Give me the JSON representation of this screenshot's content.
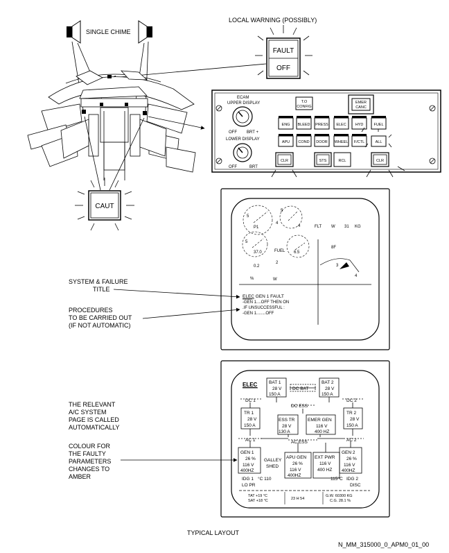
{
  "labels": {
    "local_warning": "LOCAL WARNING (POSSIBLY)",
    "single_chime": "SINGLE CHIME",
    "fault": "FAULT",
    "off": "OFF",
    "caut": "CAUT",
    "system_failure_title_1": "SYSTEM & FAILURE",
    "system_failure_title_2": "TITLE",
    "procedures_1": "PROCEDURES",
    "procedures_2": "TO BE CARRIED OUT",
    "procedures_3": "(IF NOT AUTOMATIC)",
    "relevant_1": "THE RELEVANT",
    "relevant_2": "A/C SYSTEM",
    "relevant_3": "PAGE IS CALLED",
    "relevant_4": "AUTOMATICALLY",
    "colour_1": "COLOUR FOR",
    "colour_2": "THE FAULTY",
    "colour_3": "PARAMETERS",
    "colour_4": "CHANGES TO",
    "colour_5": "AMBER",
    "typical_layout": "TYPICAL LAYOUT",
    "figure_id": "N_MM_315000_0_APM0_01_00"
  },
  "ecam_panel": {
    "ecam": "ECAM",
    "upper_display": "UPPER DISPLAY",
    "lower_display": "LOWER DISPLAY",
    "off_upper": "OFF",
    "brt_upper": "BRT +",
    "off_lower": "OFF",
    "brt_lower": "BRT",
    "to_config_1": "T.O",
    "to_config_2": "CONFIG",
    "emer_canc_1": "EMER",
    "emer_canc_2": "CANC",
    "row1": [
      "ENG",
      "BLEED",
      "PRESS",
      "ELEC",
      "HYD",
      "FUEL"
    ],
    "row2": [
      "APU",
      "COND",
      "DOOR",
      "WHEEL",
      "F/CTL",
      "ALL"
    ],
    "clr_left": "CLR",
    "sts": "STS",
    "rcl": "RCL",
    "clr_right": "CLR"
  },
  "ewd": {
    "line_title_underlined": "ELEC",
    "line_title_rest": " GEN 1 FAULT",
    "line_2": "-GEN 1....OFF THEN ON",
    "line_3": ".IF UNSUCCESSFUL :",
    "line_4": "-GEN 1........OFF",
    "gauge_marks": [
      "5",
      "P1",
      "4",
      "5",
      "4",
      "5",
      "37.0",
      "FUEL",
      "6.5",
      "0.2",
      "2",
      "FLT",
      "W",
      "8F",
      "31",
      "KG",
      "%",
      "W",
      "3",
      "4"
    ]
  },
  "elec_page": {
    "title": "ELEC",
    "bat1": [
      "BAT 1",
      "28 V",
      "150 A"
    ],
    "bat2": [
      "BAT 2",
      "28 V",
      "150 A"
    ],
    "dc_bat": "DC BAT",
    "dc1": "DC 1",
    "dc2": "DC 2",
    "dc_ess": "DC ESS",
    "tr1": [
      "TR 1",
      "28 V",
      "150 A"
    ],
    "tr2": [
      "TR 2",
      "28 V",
      "150 A"
    ],
    "ess_tr": [
      "ESS TR",
      "28 V",
      "130 A"
    ],
    "emer_gen": [
      "EMER GEN",
      "116 V",
      "400 HZ"
    ],
    "ac1": "AC 1",
    "ac2": "AC 2",
    "ac_ess": "AC ESS",
    "gen1": [
      "GEN 1",
      "26 %",
      "116 V",
      "400HZ"
    ],
    "gen2": [
      "GEN 2",
      "26 %",
      "116 V",
      "400HZ"
    ],
    "galley": [
      "GALLEY",
      "SHED"
    ],
    "apu_gen": [
      "APU GEN",
      "26 %",
      "116 V",
      "400HZ"
    ],
    "ext_pwr": [
      "EXT PWR",
      "116 V",
      "400 HZ"
    ],
    "idg1": [
      "IDG 1",
      "°C 110",
      "LO PR"
    ],
    "idg2": [
      "115°C",
      "IDG 2",
      "DISC"
    ],
    "footer": [
      "TAT +19 °C",
      "SAT +18 °C",
      "23 H 54",
      "G.W. 60300 KG",
      "C.G. 28.1 %"
    ]
  }
}
